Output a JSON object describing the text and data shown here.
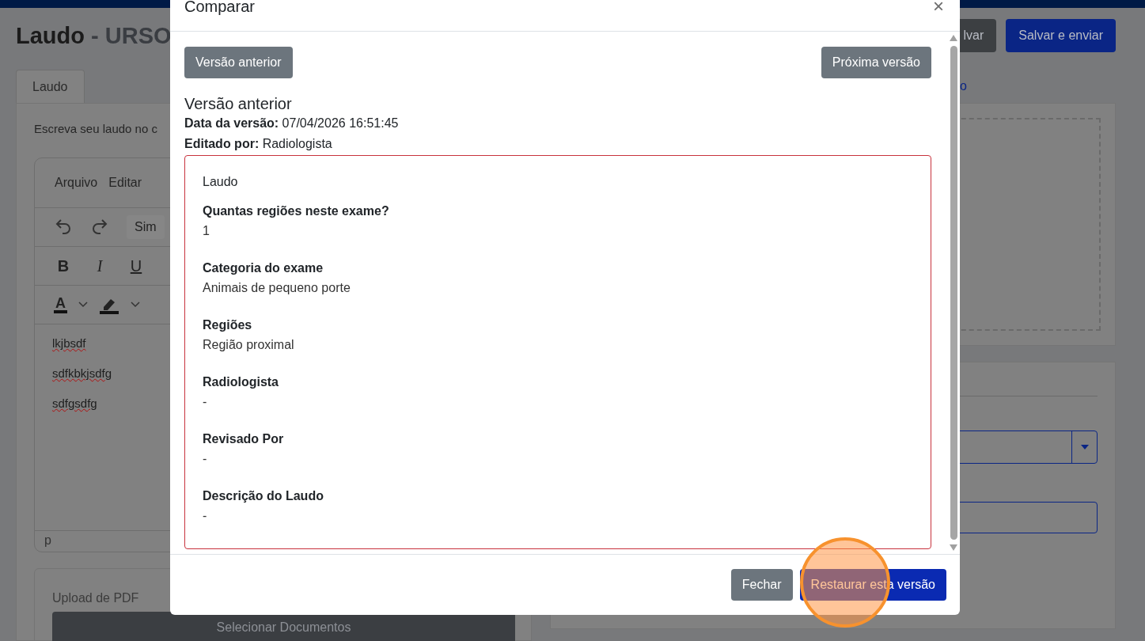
{
  "page": {
    "title": "Laudo",
    "title_suffix": "- URSO",
    "header_buttons": [
      {
        "label": "lvar",
        "kind": "secondary"
      },
      {
        "label": "Salvar e enviar",
        "kind": "primary"
      }
    ],
    "tabs": [
      {
        "label": "Laudo",
        "selected": true
      }
    ],
    "instructions": "Escreva seu laudo no c",
    "editor": {
      "menu": [
        "Arquivo",
        "Editar"
      ],
      "format_select": "Sim",
      "format_buttons": [
        {
          "label": "B",
          "kind": "bold"
        },
        {
          "label": "I",
          "kind": "italic"
        },
        {
          "label": "U",
          "kind": "underline"
        }
      ],
      "text_color": "A",
      "lines": [
        "lkjbsdf",
        "sdfkbkjsdfg",
        "sdfgsdfg"
      ],
      "status": "p"
    },
    "upload": {
      "label": "Upload de PDF",
      "button": "Selecionar Documentos"
    },
    "side_link": "o"
  },
  "modal": {
    "title": "Comparar",
    "close": "×",
    "nav_buttons": [
      "Versão anterior",
      "Próxima versão"
    ],
    "version_heading": "Versão anterior",
    "meta": [
      "**Data da versão:** 07/04/2026 16:51:45",
      "**Editado por:** Radiologista"
    ],
    "section": "Laudo",
    "fields": [
      {
        "label": "Quantas regiões neste exame?",
        "value": "1"
      },
      {
        "label": "Categoria do exame",
        "value": "Animais de pequeno porte"
      },
      {
        "label": "Regiões",
        "value": "Região proximal"
      },
      {
        "label": "Radiologista",
        "value": "-"
      },
      {
        "label": "Revisado Por",
        "value": "-"
      },
      {
        "label": "Descrição do Laudo",
        "value": "-"
      }
    ],
    "buttons": [
      {
        "label": "Fechar",
        "kind": "secondary"
      },
      {
        "label": "Restaurar esta versão",
        "kind": "primary"
      }
    ]
  }
}
